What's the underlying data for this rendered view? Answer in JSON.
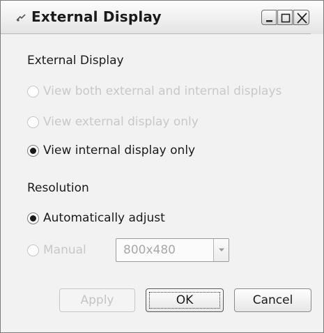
{
  "window": {
    "title": "External Display",
    "icon": "display-app-icon",
    "controls": {
      "minimize": "minimize-icon",
      "maximize": "maximize-icon",
      "close": "close-icon"
    }
  },
  "external_display": {
    "heading": "External Display",
    "options": [
      {
        "label": "View both external and internal displays",
        "selected": false,
        "enabled": false
      },
      {
        "label": "View external display only",
        "selected": false,
        "enabled": false
      },
      {
        "label": "View internal display only",
        "selected": true,
        "enabled": true
      }
    ]
  },
  "resolution": {
    "heading": "Resolution",
    "auto_label": "Automatically adjust",
    "auto_selected": true,
    "manual_label": "Manual",
    "manual_enabled": false,
    "manual_value": "800x480"
  },
  "buttons": {
    "apply": "Apply",
    "ok": "OK",
    "cancel": "Cancel"
  }
}
